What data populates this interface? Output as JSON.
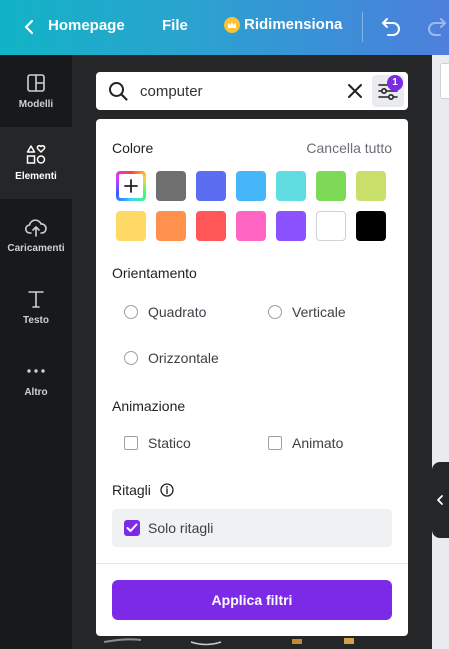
{
  "topbar": {
    "back_label": "Homepage",
    "file_label": "File",
    "resize_label": "Ridimensiona"
  },
  "rail": [
    {
      "label": "Modelli",
      "icon": "layout-icon"
    },
    {
      "label": "Elementi",
      "icon": "shapes-icon"
    },
    {
      "label": "Caricamenti",
      "icon": "cloud-upload-icon"
    },
    {
      "label": "Testo",
      "icon": "text-icon"
    },
    {
      "label": "Altro",
      "icon": "more-icon"
    }
  ],
  "search": {
    "value": "computer",
    "filter_count": "1"
  },
  "filters": {
    "color_title": "Colore",
    "clear_all": "Cancella tutto",
    "colors": [
      "#6f6f6f",
      "#5b6ef2",
      "#45b6f7",
      "#5fdde0",
      "#7ed957",
      "#c8e06a",
      "#ffd966",
      "#ff914d",
      "#ff5757",
      "#ff66c4",
      "#8c52ff",
      "#ffffff",
      "#000000"
    ],
    "orientation_title": "Orientamento",
    "orientation_options": [
      "Quadrato",
      "Verticale",
      "Orizzontale"
    ],
    "animation_title": "Animazione",
    "animation_options": [
      "Statico",
      "Animato"
    ],
    "cutouts_title": "Ritagli",
    "cutouts_option": "Solo ritagli",
    "apply_label": "Applica filtri"
  },
  "colors": {
    "accent": "#7d2ae8",
    "panel": "#252627",
    "rail": "#18191b"
  }
}
